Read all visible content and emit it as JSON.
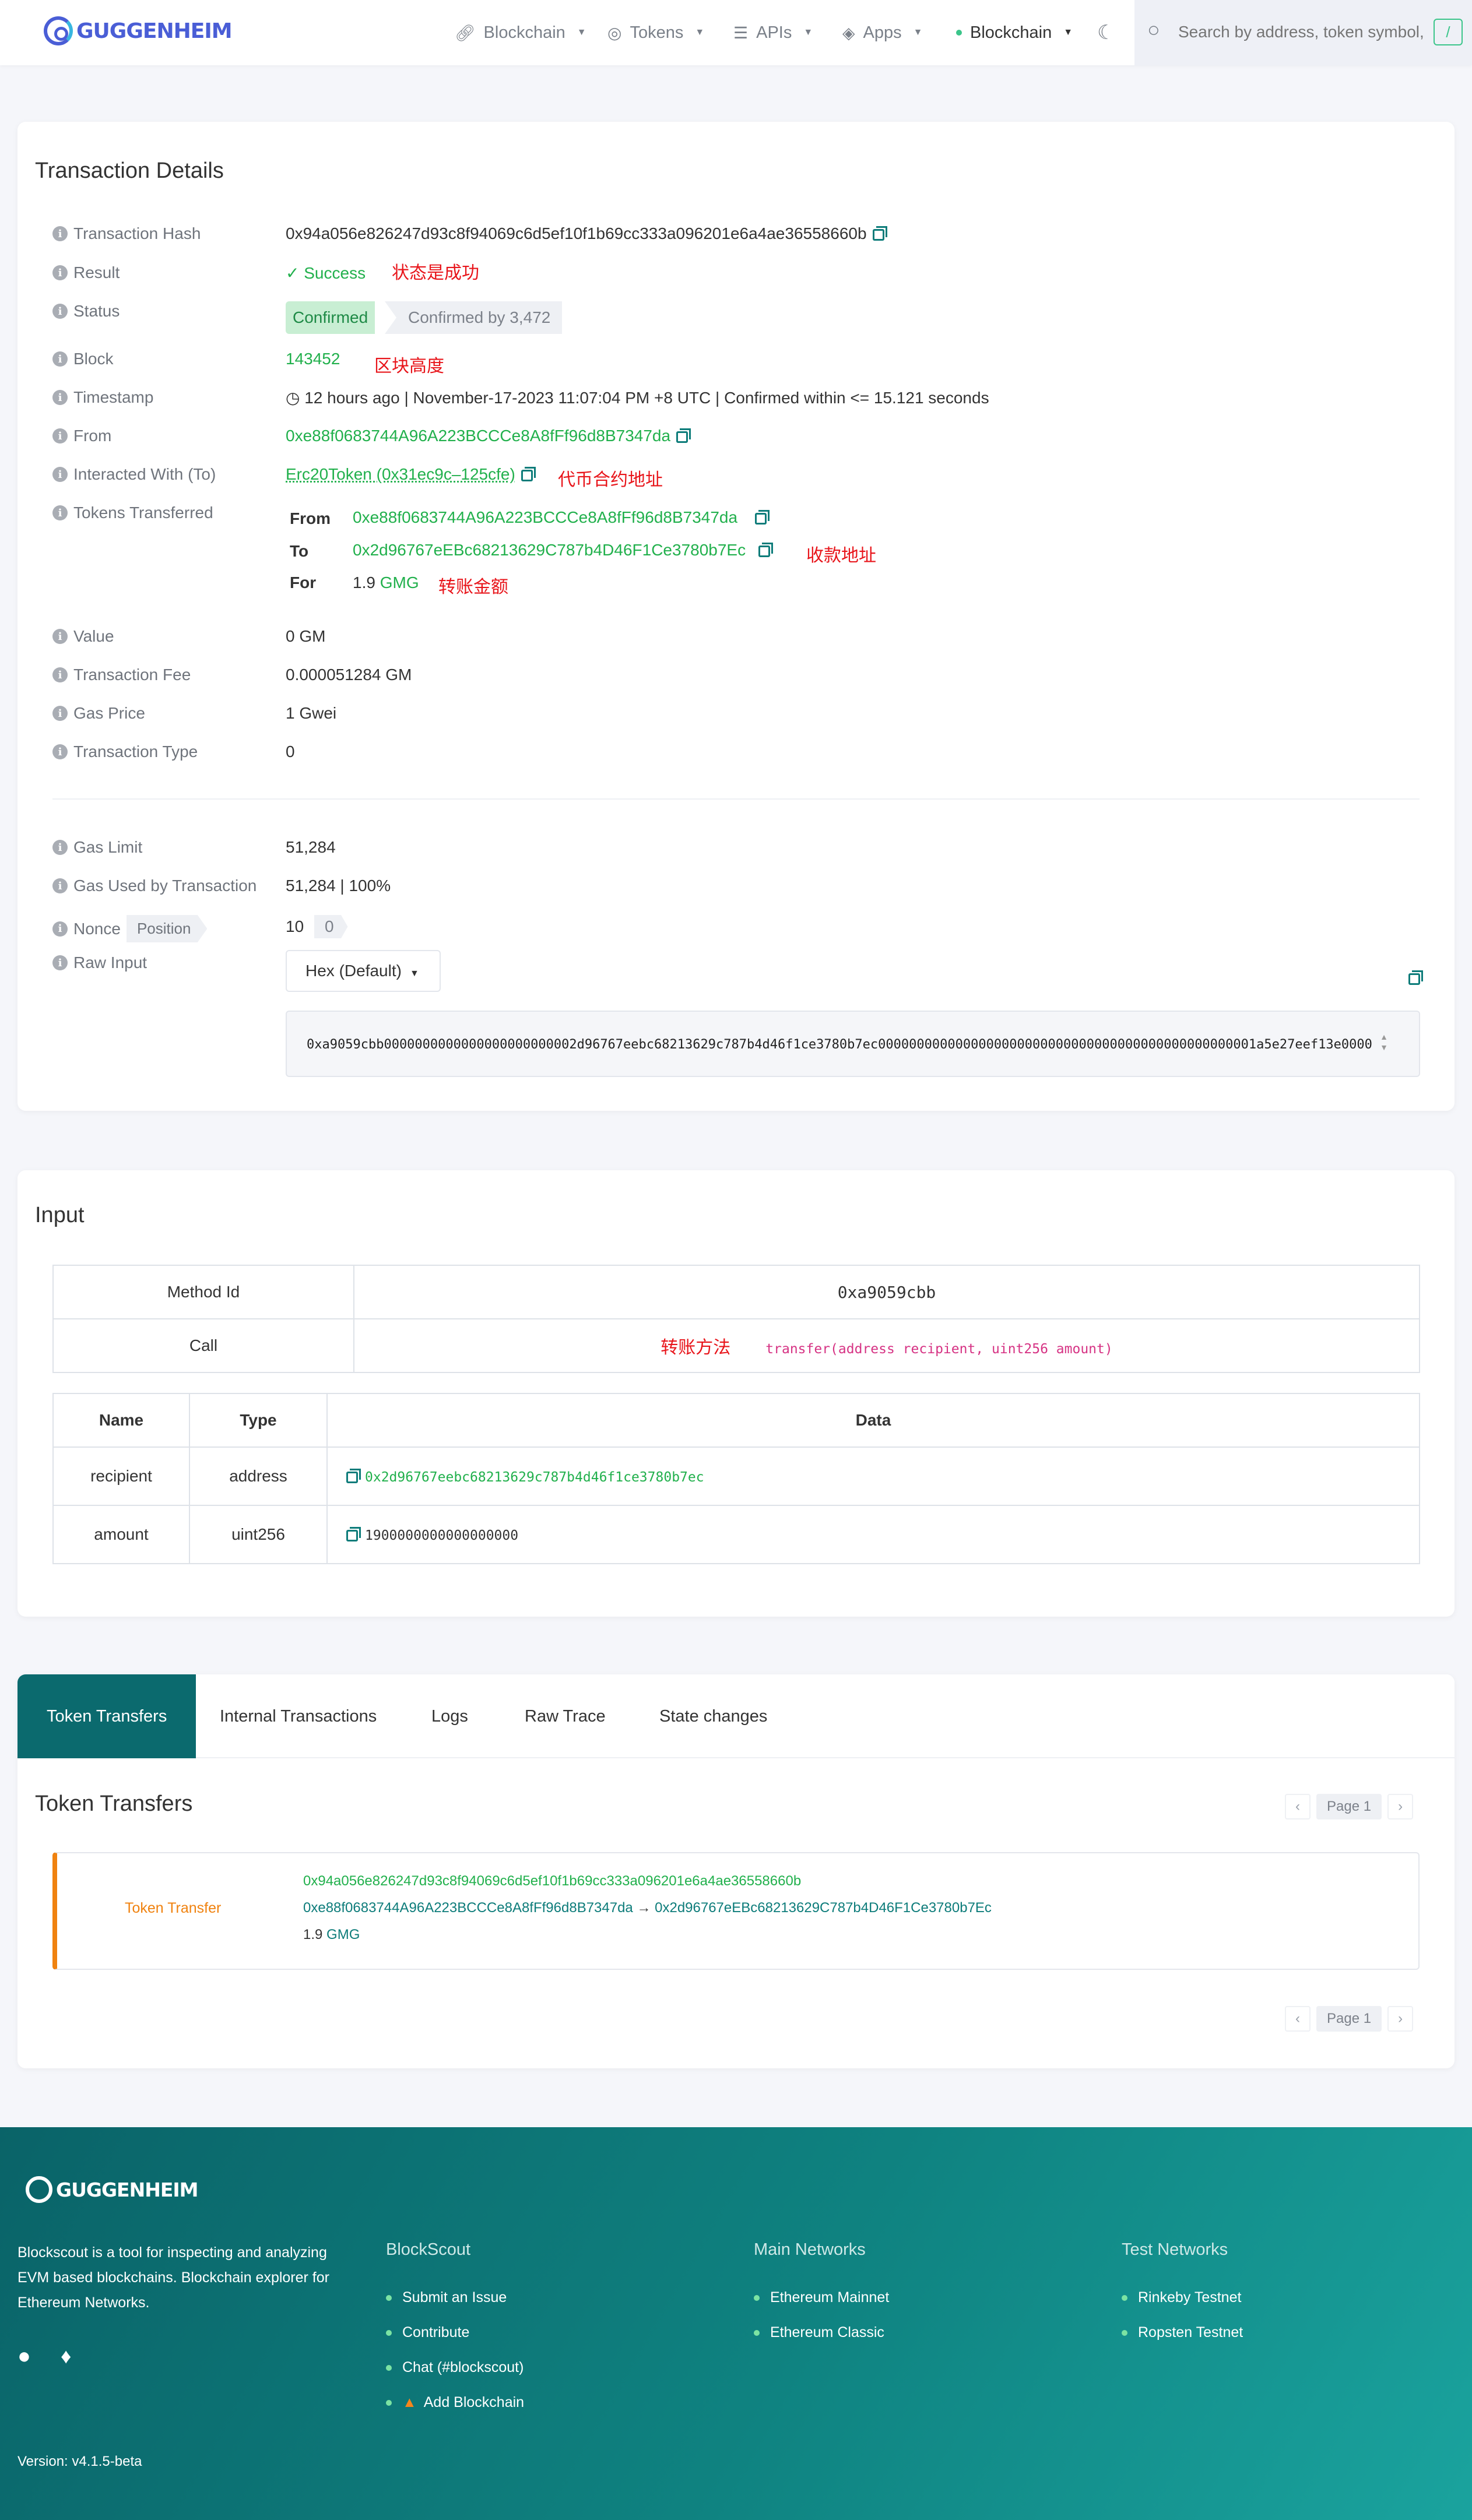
{
  "header": {
    "logo": "GUGGENHEIM",
    "nav": [
      {
        "icon": "link-icon",
        "label": "Blockchain"
      },
      {
        "icon": "coins-icon",
        "label": "Tokens"
      },
      {
        "icon": "sliders-icon",
        "label": "APIs"
      },
      {
        "icon": "layers-icon",
        "label": "Apps"
      }
    ],
    "network": "Blockchain",
    "search_placeholder": "Search by address, token symbol, n",
    "search_shortcut": "/"
  },
  "details": {
    "title": "Transaction Details",
    "labels": {
      "hash": "Transaction Hash",
      "result": "Result",
      "status": "Status",
      "block": "Block",
      "timestamp": "Timestamp",
      "from": "From",
      "interacted": "Interacted With (To)",
      "tokens": "Tokens Transferred",
      "value": "Value",
      "fee": "Transaction Fee",
      "gas_price": "Gas Price",
      "tx_type": "Transaction Type",
      "gas_limit": "Gas Limit",
      "gas_used": "Gas Used by Transaction",
      "nonce": "Nonce",
      "position": "Position",
      "raw_input": "Raw Input"
    },
    "hash": "0x94a056e826247d93c8f94069c6d5ef10f1b69cc333a096201e6a4ae36558660b",
    "result": "Success",
    "result_note": "状态是成功",
    "status_badge": "Confirmed",
    "confirmed_by": "Confirmed by 3,472",
    "block": "143452",
    "block_note": "区块高度",
    "timestamp": "12 hours ago | November-17-2023 11:07:04 PM +8 UTC | Confirmed within <= 15.121 seconds",
    "from": "0xe88f0683744A96A223BCCCe8A8fFf96d8B7347da",
    "interacted": "Erc20Token (0x31ec9c–125cfe)",
    "interacted_note": "代币合约地址",
    "transfer": {
      "from_label": "From",
      "from": "0xe88f0683744A96A223BCCCe8A8fFf96d8B7347da",
      "to_label": "To",
      "to": "0x2d96767eEBc68213629C787b4D46F1Ce3780b7Ec",
      "to_note": "收款地址",
      "for_label": "For",
      "amount": "1.9",
      "token": "GMG",
      "amount_note": "转账金额"
    },
    "value": "0 GM",
    "fee": "0.000051284 GM",
    "gas_price": "1 Gwei",
    "tx_type": "0",
    "gas_limit": "51,284",
    "gas_used": "51,284 | 100%",
    "nonce": "10",
    "position": "0",
    "raw_select": "Hex (Default)",
    "raw_input": "0xa9059cbb0000000000000000000000002d96767eebc68213629c787b4d46f1ce3780b7ec0000000000000000000000000000000000000000000000001a5e27eef13e0000"
  },
  "input": {
    "title": "Input",
    "method_label": "Method Id",
    "method_id": "0xa9059cbb",
    "call_label": "Call",
    "call_note": "转账方法",
    "call": "transfer(address recipient, uint256 amount)",
    "headers": [
      "Name",
      "Type",
      "Data"
    ],
    "rows": [
      {
        "name": "recipient",
        "type": "address",
        "data": "0x2d96767eebc68213629c787b4d46f1ce3780b7ec"
      },
      {
        "name": "amount",
        "type": "uint256",
        "data": "1900000000000000000"
      }
    ]
  },
  "tabs": [
    "Token Transfers",
    "Internal Transactions",
    "Logs",
    "Raw Trace",
    "State changes"
  ],
  "transfers": {
    "title": "Token Transfers",
    "page": "Page 1",
    "tile_type": "Token Transfer",
    "tx_hash": "0x94a056e826247d93c8f94069c6d5ef10f1b69cc333a096201e6a4ae36558660b",
    "from": "0xe88f0683744A96A223BCCCe8A8fFf96d8B7347da",
    "arrow": "→",
    "to": "0x2d96767eEBc68213629C787b4D46F1Ce3780b7Ec",
    "amount": "1.9",
    "token": "GMG"
  },
  "footer": {
    "logo": "GUGGENHEIM",
    "about": "Blockscout is a tool for inspecting and analyzing EVM based blockchains. Blockchain explorer for Ethereum Networks.",
    "cols": [
      {
        "title": "BlockScout",
        "items": [
          "Submit an Issue",
          "Contribute",
          "Chat (#blockscout)",
          "Add Blockchain"
        ]
      },
      {
        "title": "Main Networks",
        "items": [
          "Ethereum Mainnet",
          "Ethereum Classic"
        ]
      },
      {
        "title": "Test Networks",
        "items": [
          "Rinkeby Testnet",
          "Ropsten Testnet"
        ]
      }
    ],
    "version": "Version: v4.1.5-beta"
  },
  "colors": {
    "accent": "#0b6a6e",
    "success": "#21b04c",
    "note": "#e8141a",
    "brand": "#4a5ed6"
  }
}
